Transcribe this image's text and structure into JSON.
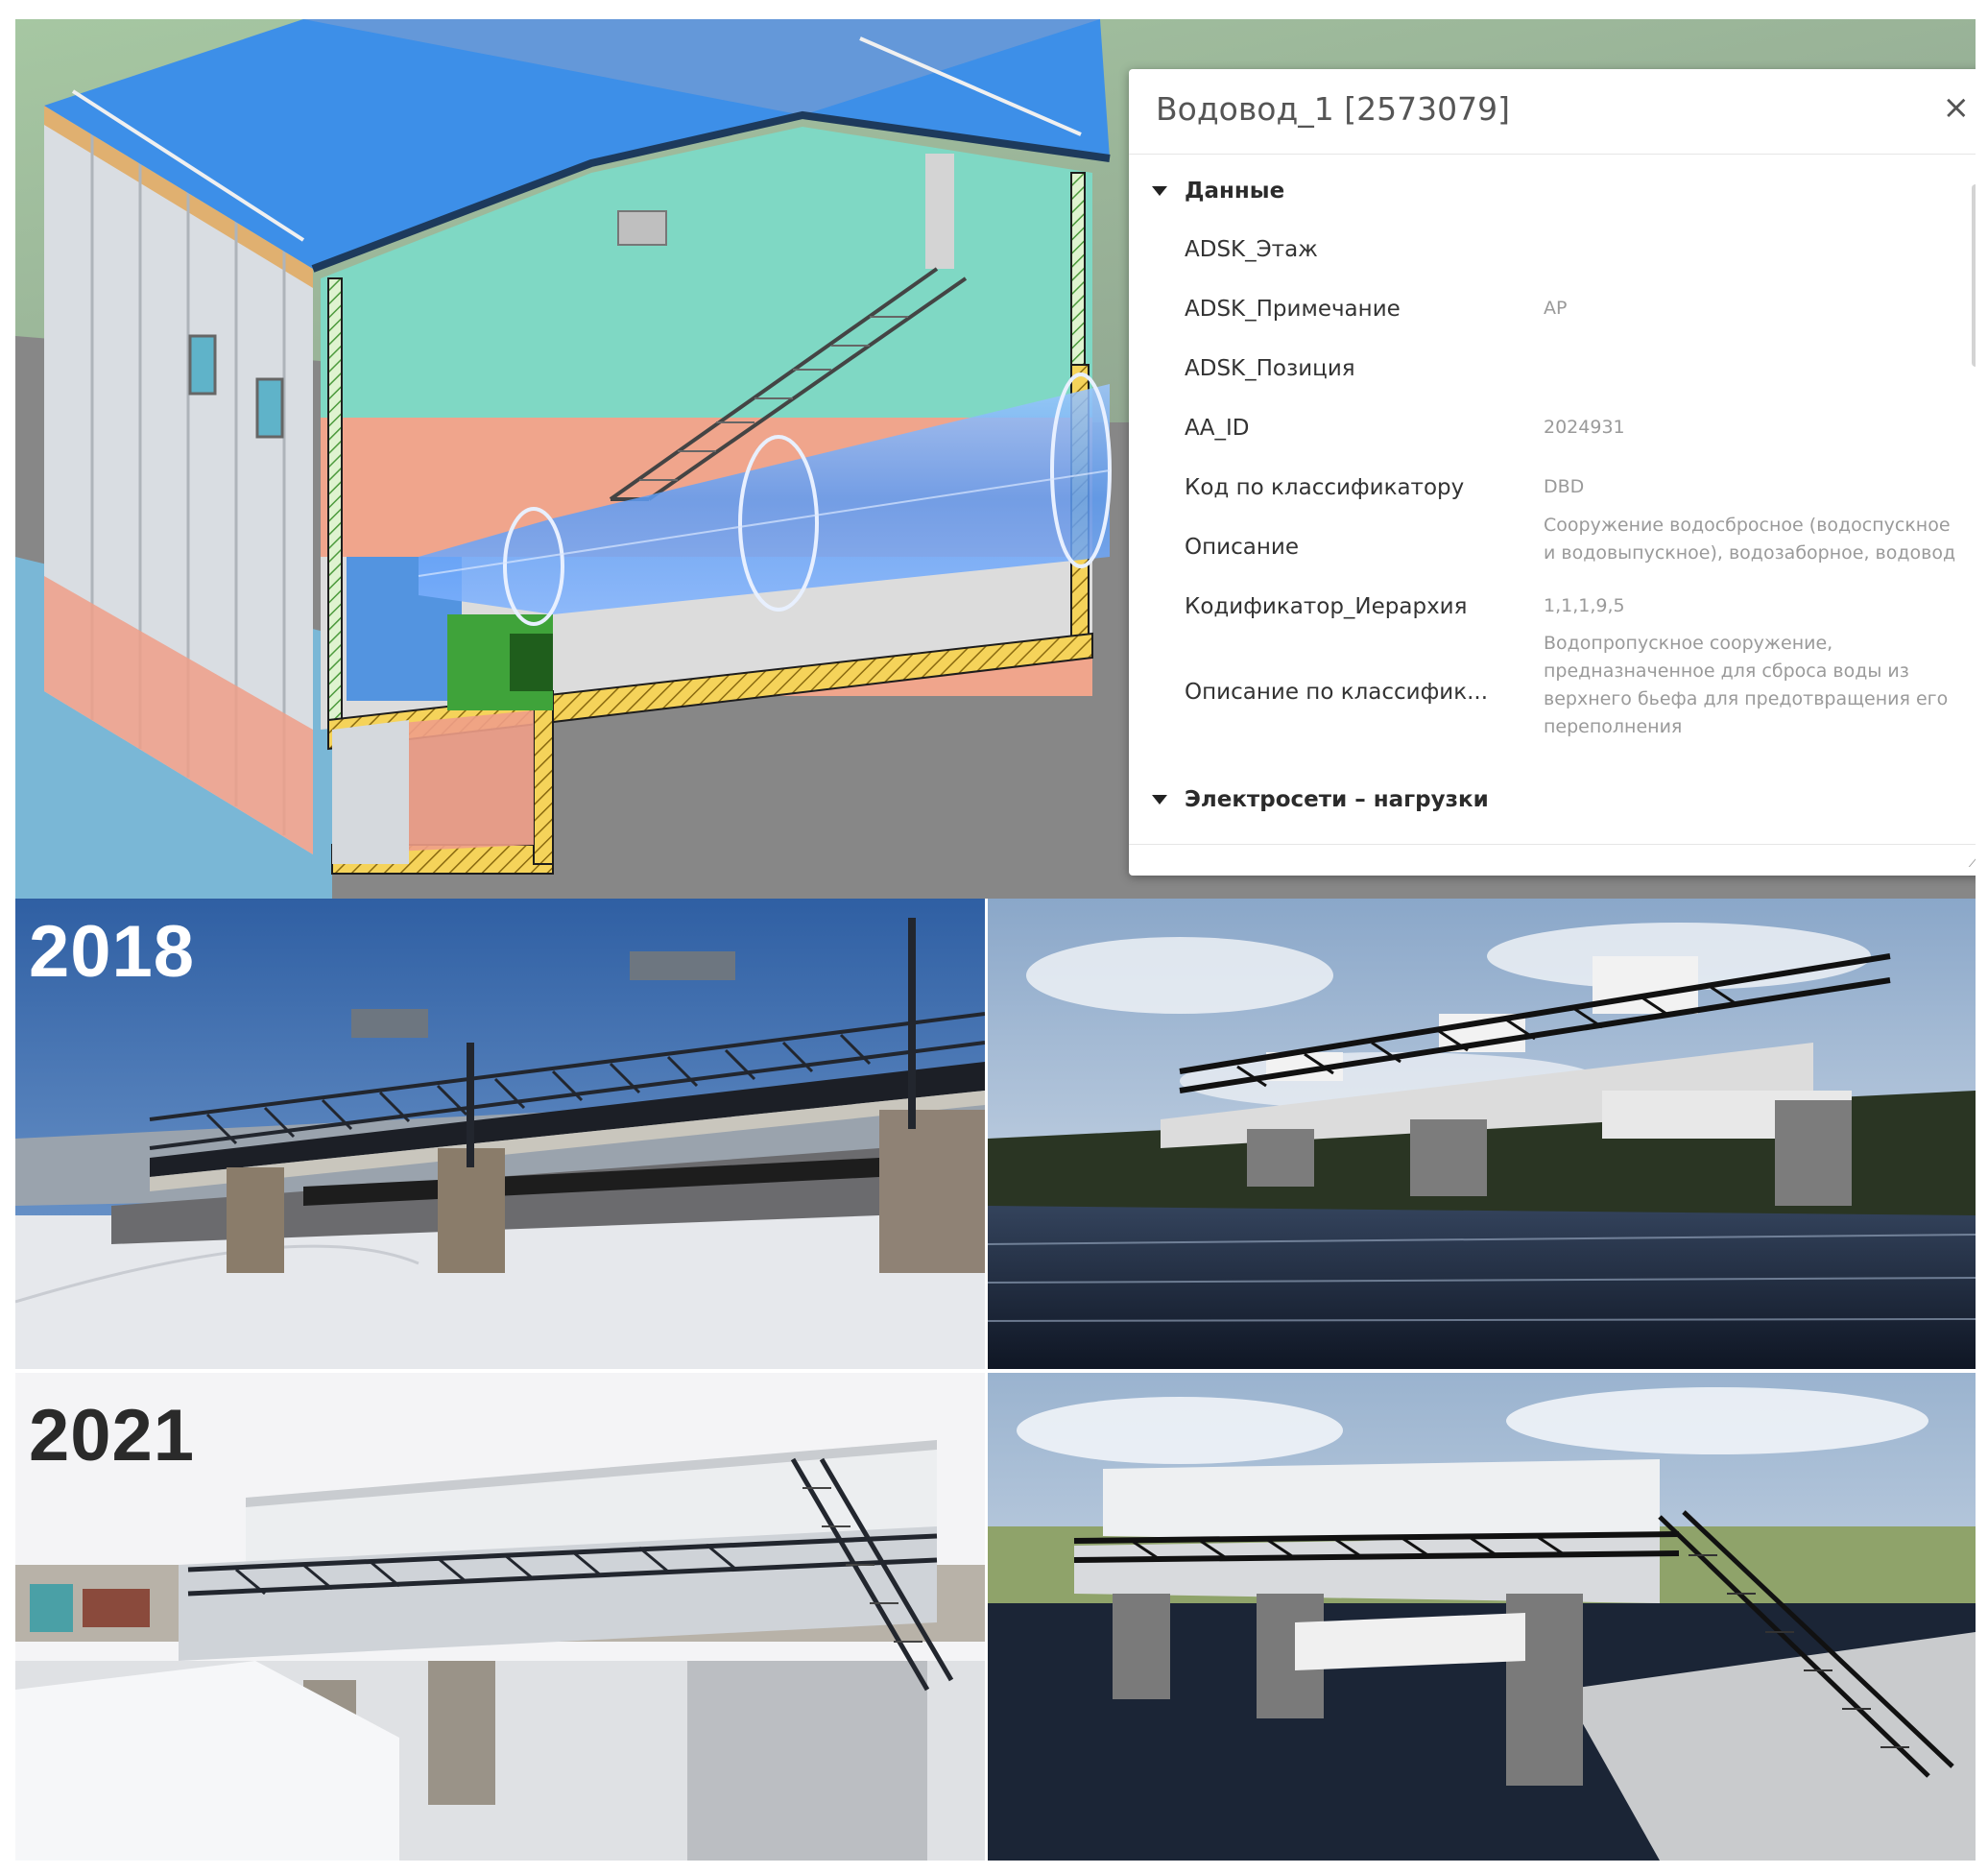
{
  "properties_panel": {
    "title": "Водовод_1 [2573079]",
    "close_label": "×",
    "sections": [
      {
        "label": "Данные",
        "rows": [
          {
            "name": "ADSK_Этаж",
            "value": ""
          },
          {
            "name": "ADSK_Примечание",
            "value": "АР"
          },
          {
            "name": "ADSK_Позиция",
            "value": ""
          },
          {
            "name": "АА_ID",
            "value": "2024931"
          },
          {
            "name": "Код по классификатору",
            "value": "DBD"
          },
          {
            "name": "Описание",
            "value": "Сооружение водосбросное (водоспускное и водовыпускное), водозаборное, водовод"
          },
          {
            "name": "Кодификатор_Иерархия",
            "value": "1,1,1,9,5"
          },
          {
            "name": "Описание по классифик...",
            "value": "Водопропускное сооружение, предназначенное для сброса воды из верхнего бьефа для предотвращения его переполнения"
          }
        ]
      },
      {
        "label": "Электросети – нагрузки",
        "rows": []
      }
    ]
  },
  "photos": {
    "year_1": "2018",
    "year_2": "2021"
  },
  "colors": {
    "roof_blue": "#3d8fe8",
    "wall_teal": "#7fd8c4",
    "wall_salmon": "#f0a58c",
    "pipe_blue": "#6aa8ff",
    "hatch_yellow": "#e8c23a",
    "sky_blue": "#4f86c9"
  }
}
